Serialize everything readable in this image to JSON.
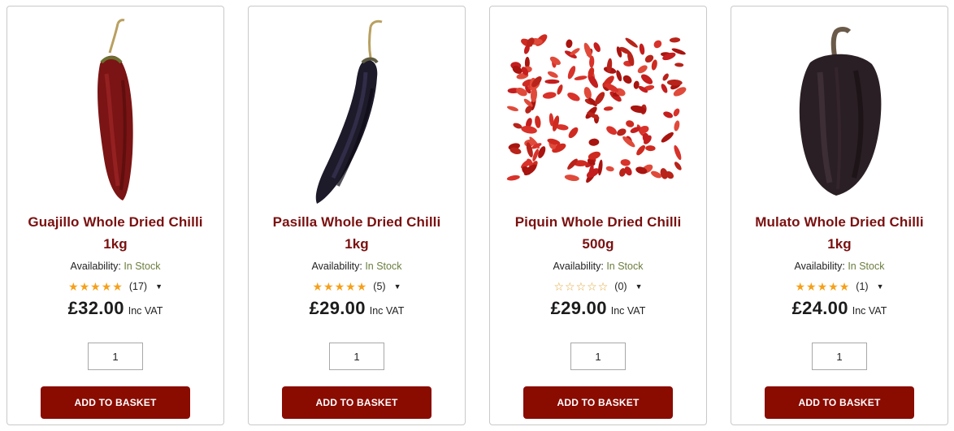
{
  "products": [
    {
      "title": "Guajillo Whole Dried Chilli 1kg",
      "availability_label": "Availability:",
      "availability_status": "In Stock",
      "rating": 5,
      "review_count": "(17)",
      "price": "£32.00",
      "vat_label": "Inc VAT",
      "quantity": "1",
      "button_label": "ADD TO BASKET",
      "image_icon": "guajillo-chilli-image"
    },
    {
      "title": "Pasilla Whole Dried Chilli 1kg",
      "availability_label": "Availability:",
      "availability_status": "In Stock",
      "rating": 5,
      "review_count": "(5)",
      "price": "£29.00",
      "vat_label": "Inc VAT",
      "quantity": "1",
      "button_label": "ADD TO BASKET",
      "image_icon": "pasilla-chilli-image"
    },
    {
      "title": "Piquin Whole Dried Chilli 500g",
      "availability_label": "Availability:",
      "availability_status": "In Stock",
      "rating": 0,
      "review_count": "(0)",
      "price": "£29.00",
      "vat_label": "Inc VAT",
      "quantity": "1",
      "button_label": "ADD TO BASKET",
      "image_icon": "piquin-chilli-image"
    },
    {
      "title": "Mulato Whole Dried Chilli 1kg",
      "availability_label": "Availability:",
      "availability_status": "In Stock",
      "rating": 5,
      "review_count": "(1)",
      "price": "£24.00",
      "vat_label": "Inc VAT",
      "quantity": "1",
      "button_label": "ADD TO BASKET",
      "image_icon": "mulato-chilli-image"
    }
  ],
  "colors": {
    "title": "#7a1010",
    "in_stock": "#6b7d3e",
    "star": "#f5a01a",
    "button_bg": "#8a0b00"
  }
}
